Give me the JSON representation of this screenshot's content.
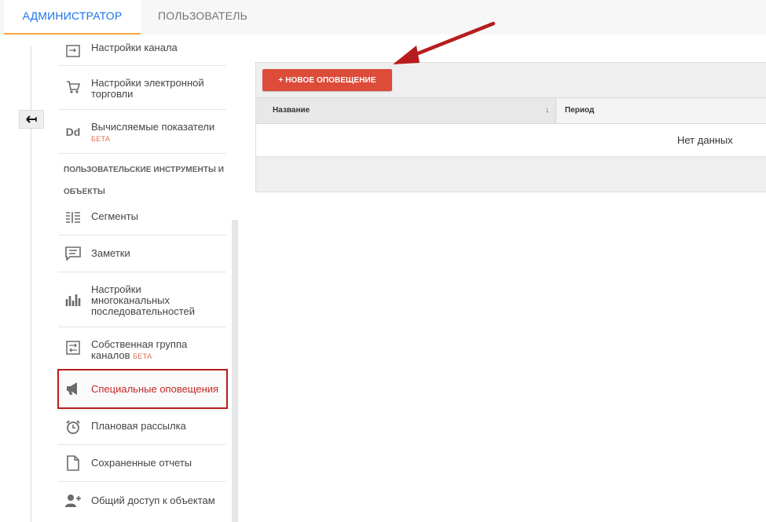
{
  "tabs": {
    "admin": "АДМИНИСТРАТОР",
    "user": "ПОЛЬЗОВАТЕЛЬ"
  },
  "sidebar": {
    "back_icon": "back-arrow-icon",
    "items_top": [
      {
        "label": "Настройки канала",
        "icon": "channel-settings-icon"
      },
      {
        "label_line1": "Настройки электронной",
        "label_line2": "торговли",
        "icon": "cart-icon"
      },
      {
        "label": "Вычисляемые показатели",
        "badge": "БЕТА",
        "icon": "calculated-metrics-icon"
      }
    ],
    "section_title_line1": "ПОЛЬЗОВАТЕЛЬСКИЕ ИНСТРУМЕНТЫ И",
    "section_title_line2": "ОБЪЕКТЫ",
    "items": [
      {
        "label": "Сегменты",
        "icon": "segments-icon"
      },
      {
        "label": "Заметки",
        "icon": "notes-icon"
      },
      {
        "label_line1": "Настройки",
        "label_line2": "многоканальных",
        "label_line3": "последовательностей",
        "icon": "multichannel-icon"
      },
      {
        "label_line1": "Собственная группа",
        "label_line2": "каналов",
        "badge": "БЕТА",
        "icon": "channel-group-icon"
      },
      {
        "label": "Специальные оповещения",
        "icon": "megaphone-icon",
        "active": true
      },
      {
        "label": "Плановая рассылка",
        "icon": "alarm-clock-icon"
      },
      {
        "label": "Сохраненные отчеты",
        "icon": "document-icon"
      },
      {
        "label": "Общий доступ к объектам",
        "icon": "add-person-icon"
      }
    ]
  },
  "main": {
    "new_button": "+ НОВОЕ ОПОВЕЩЕНИЕ",
    "columns": [
      "Название",
      "Период"
    ],
    "sort_indicator": "↓",
    "empty_text": "Нет данных"
  },
  "colors": {
    "accent_blue": "#1a73e8",
    "tab_underline": "#f4a63a",
    "button_red": "#dd4b39",
    "highlight_border": "#b71c1c",
    "arrow": "#b71c1c"
  }
}
